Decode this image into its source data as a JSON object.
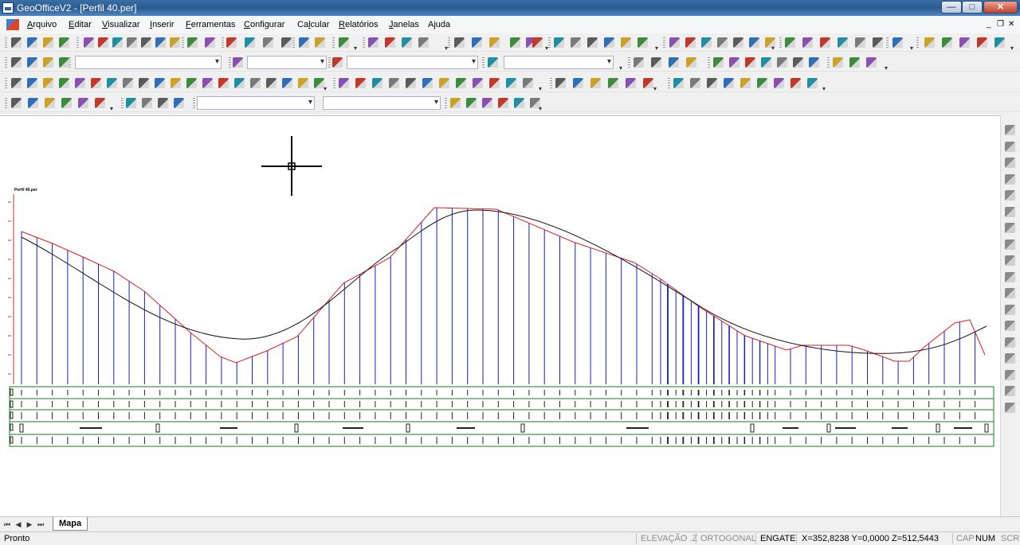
{
  "window": {
    "title": "GeoOfficeV2 - [Perfil 40.per]",
    "minimize": "—",
    "maximize": "□",
    "close": "✕"
  },
  "menu": {
    "items": [
      {
        "pre": "",
        "u": "A",
        "post": "rquivo"
      },
      {
        "pre": "",
        "u": "E",
        "post": "ditar"
      },
      {
        "pre": "",
        "u": "V",
        "post": "isualizar"
      },
      {
        "pre": "",
        "u": "I",
        "post": "nserir"
      },
      {
        "pre": "",
        "u": "F",
        "post": "erramentas"
      },
      {
        "pre": "",
        "u": "C",
        "post": "onfigurar"
      },
      {
        "pre": "Ca",
        "u": "l",
        "post": "cular"
      },
      {
        "pre": "",
        "u": "R",
        "post": "elatórios"
      },
      {
        "pre": "",
        "u": "J",
        "post": "anelas"
      },
      {
        "pre": "A",
        "u": "j",
        "post": "uda"
      }
    ],
    "mdi_min": "_",
    "mdi_restore": "❐",
    "mdi_close": "✕"
  },
  "drawing": {
    "profile_label": "Perfil 40.per",
    "terrain_color": "#e02020",
    "design_color": "#111111",
    "station_color": "#2020b0",
    "band_color": "#1f7a1f"
  },
  "tabs": {
    "nav": [
      "⏮",
      "◀",
      "▶",
      "⏭"
    ],
    "active": "Mapa"
  },
  "status": {
    "ready": "Pronto",
    "elevacao": "ELEVAÇÃO .Z",
    "ortogonal": "ORTOGONAL",
    "engate": "ENGATE",
    "coords": "X=352,8238 Y=0,0000 Z=512,5443",
    "cap": "CAP",
    "num": "NUM",
    "scrl": "SCRL"
  }
}
